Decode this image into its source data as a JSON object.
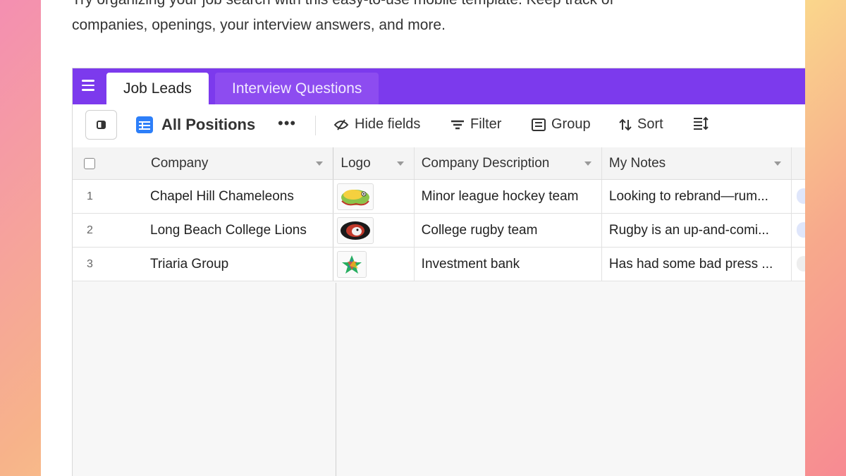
{
  "intro": {
    "line1": "Try organizing your job search with this easy-to-use mobile template. Keep track of",
    "line2": "companies, openings, your interview answers, and more."
  },
  "tabs": {
    "active": "Job Leads",
    "inactive": "Interview Questions"
  },
  "toolbar": {
    "view_name": "All Positions",
    "more": "•••",
    "hide_fields": "Hide fields",
    "filter": "Filter",
    "group": "Group",
    "sort": "Sort"
  },
  "columns": {
    "company": "Company",
    "logo": "Logo",
    "description": "Company Description",
    "notes": "My Notes"
  },
  "rows": [
    {
      "num": "1",
      "company": "Chapel Hill Chameleons",
      "description": "Minor league hockey team",
      "notes": "Looking to rebrand—rum..."
    },
    {
      "num": "2",
      "company": "Long Beach College Lions",
      "description": "College rugby team",
      "notes": "Rugby is an up-and-comi..."
    },
    {
      "num": "3",
      "company": "Triaria Group",
      "description": "Investment bank",
      "notes": "Has had some bad press ..."
    }
  ],
  "colors": {
    "accent": "#7c3aed",
    "grid_icon": "#2d7ff9"
  },
  "icons": {
    "menu": "hamburger-icon",
    "sidebar": "sidebar-toggle-icon",
    "grid": "grid-view-icon",
    "hide_fields": "eye-slash-icon",
    "filter": "filter-icon",
    "group": "group-icon",
    "sort": "sort-icon",
    "row_height": "row-height-icon"
  }
}
